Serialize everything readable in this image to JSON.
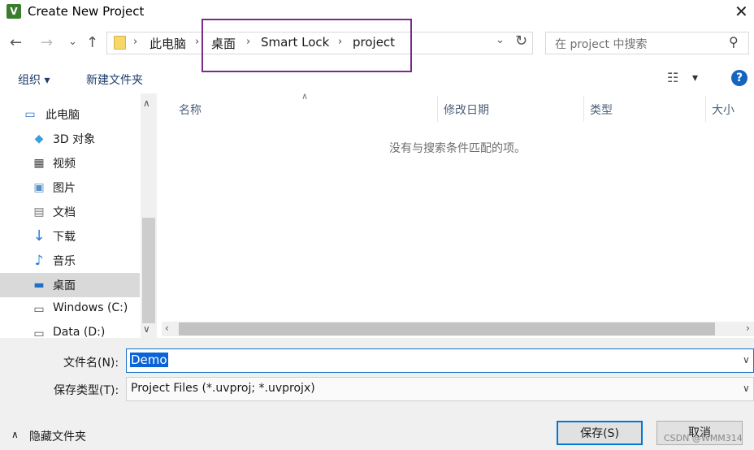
{
  "window": {
    "title": "Create New Project",
    "close_glyph": "✕"
  },
  "nav": {
    "back": "←",
    "forward": "→",
    "history": "⌄",
    "up": "↑"
  },
  "breadcrumb": {
    "items": [
      "此电脑",
      "桌面",
      "Smart Lock",
      "project"
    ],
    "separator": "›"
  },
  "search": {
    "placeholder": "在 project 中搜索"
  },
  "toolbar": {
    "organize": "组织 ▾",
    "new_folder": "新建文件夹",
    "view_icon": "☷",
    "view_drop": "▾",
    "help": "?"
  },
  "nav_pane": {
    "items": [
      {
        "label": "此电脑",
        "icon": "computer-icon"
      },
      {
        "label": "3D 对象",
        "icon": "3d-objects-icon"
      },
      {
        "label": "视频",
        "icon": "video-icon"
      },
      {
        "label": "图片",
        "icon": "pictures-icon"
      },
      {
        "label": "文档",
        "icon": "documents-icon"
      },
      {
        "label": "下载",
        "icon": "download-icon"
      },
      {
        "label": "音乐",
        "icon": "music-icon"
      },
      {
        "label": "桌面",
        "icon": "desktop-icon"
      },
      {
        "label": "Windows (C:)",
        "icon": "drive-c-icon"
      },
      {
        "label": "Data (D:)",
        "icon": "drive-d-icon"
      }
    ],
    "selected": "桌面"
  },
  "file_list": {
    "columns": [
      "名称",
      "修改日期",
      "类型",
      "大小"
    ],
    "empty_message": "没有与搜索条件匹配的项。"
  },
  "form": {
    "filename_label": "文件名(N):",
    "filename_value": "Demo",
    "filetype_label": "保存类型(T):",
    "filetype_value": "Project Files (*.uvproj; *.uvprojx)"
  },
  "footer": {
    "hide_folders": "隐藏文件夹",
    "save": "保存(S)",
    "cancel": "取消"
  },
  "watermark": "CSDN @WMM314",
  "colors": {
    "accent": "#0078d7",
    "highlight_box": "#7b2a8a",
    "selection": "#0a64d8"
  }
}
